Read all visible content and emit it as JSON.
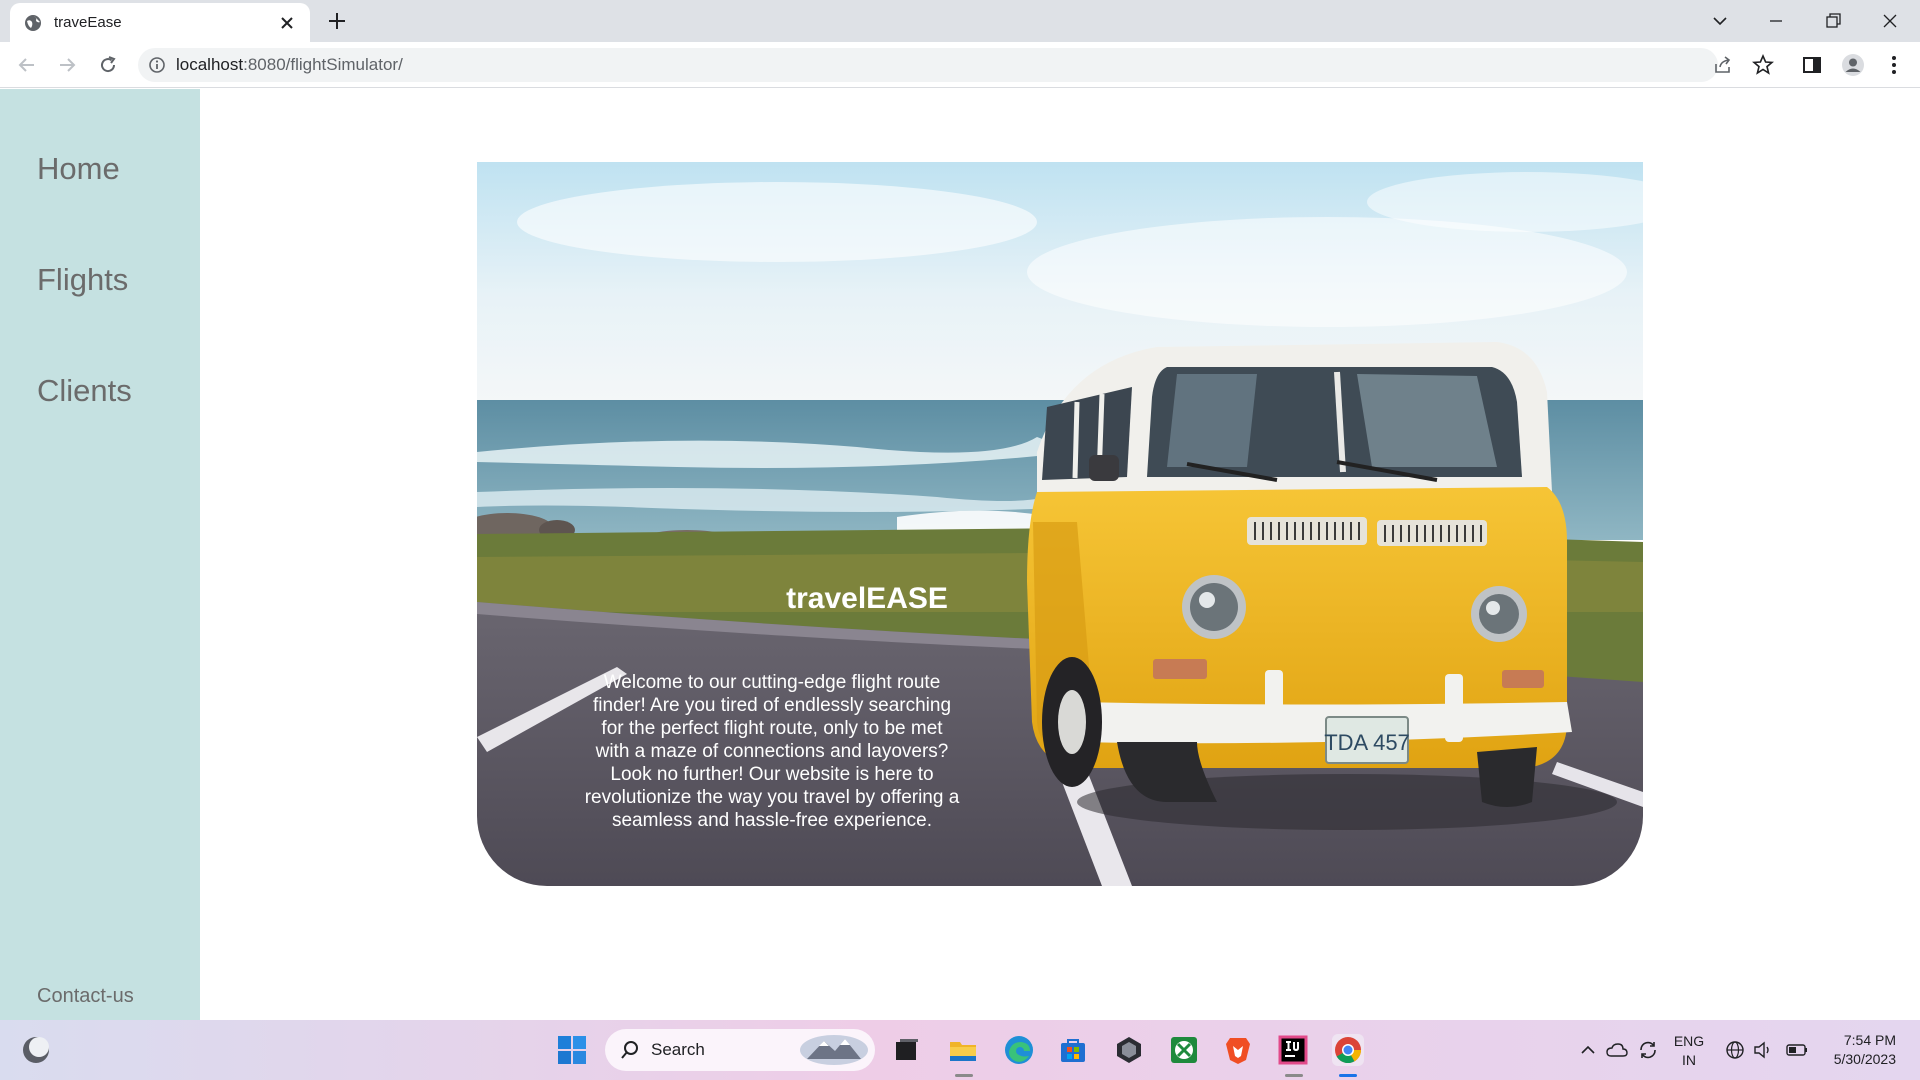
{
  "browser": {
    "tab_title": "traveEase",
    "url_host": "localhost",
    "url_rest": ":8080/flightSimulator/"
  },
  "sidebar": {
    "items": [
      {
        "label": "Home"
      },
      {
        "label": "Flights"
      },
      {
        "label": "Clients"
      }
    ],
    "contact_label": "Contact-us"
  },
  "hero": {
    "title": "travelEASE",
    "description": "Welcome to our cutting-edge flight route finder! Are you tired of endlessly searching for the perfect flight route, only to be met with a maze of connections and layovers? Look no further! Our website is here to revolutionize the way you travel by offering a seamless and hassle-free experience.",
    "plate_text": "TDA 457"
  },
  "taskbar": {
    "search_label": "Search",
    "lang_line1": "ENG",
    "lang_line2": "IN",
    "time": "7:54 PM",
    "date": "5/30/2023"
  },
  "colors": {
    "sidebar_bg": "#c5e1e1",
    "nav_text": "#6b6b6b",
    "van_yellow": "#f2b61c"
  }
}
